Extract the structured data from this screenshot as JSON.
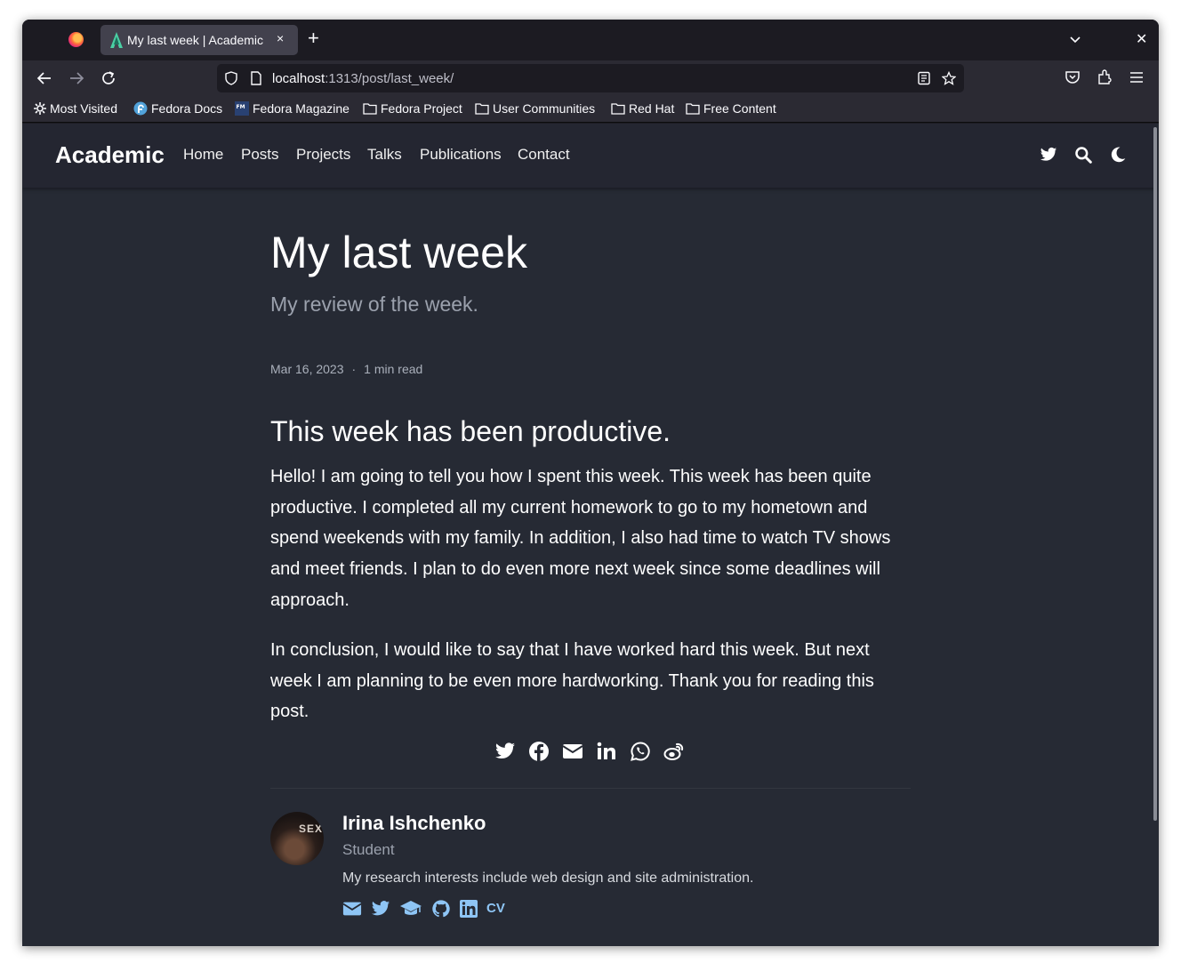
{
  "browser": {
    "tab_title": "My last week | Academic",
    "tab_close": "×",
    "new_tab": "+",
    "window_close": "✕",
    "url_host": "localhost",
    "url_path": ":1313/post/last_week/",
    "bookmarks": [
      "Most Visited",
      "Fedora Docs",
      "Fedora Magazine",
      "Fedora Project",
      "User Communities",
      "Red Hat",
      "Free Content"
    ]
  },
  "site": {
    "brand": "Academic",
    "menu": [
      "Home",
      "Posts",
      "Projects",
      "Talks",
      "Publications",
      "Contact"
    ]
  },
  "post": {
    "title": "My last week",
    "subtitle": "My review of the week.",
    "date": "Mar 16, 2023",
    "meta_separator": "·",
    "read_time": "1 min read",
    "heading": "This week has been productive.",
    "paragraph1": "Hello! I am going to tell you how I spent this week. This week has been quite productive. I completed all my current homework to go to my hometown and spend weekends with my family. In addition, I also had time to watch TV shows and meet friends. I plan to do even more next week since some deadlines will approach.",
    "paragraph2": "In conclusion, I would like to say that I have worked hard this week. But next week I am planning to be even more hardworking. Thank you for reading this post."
  },
  "author": {
    "name": "Irina Ishchenko",
    "role": "Student",
    "bio": "My research interests include web design and site administration.",
    "avatar_text": "SEX",
    "cv_label": "CV"
  },
  "colors": {
    "accent": "#8ec5f5",
    "page_bg": "#262a34",
    "nav_bg": "#242631"
  }
}
